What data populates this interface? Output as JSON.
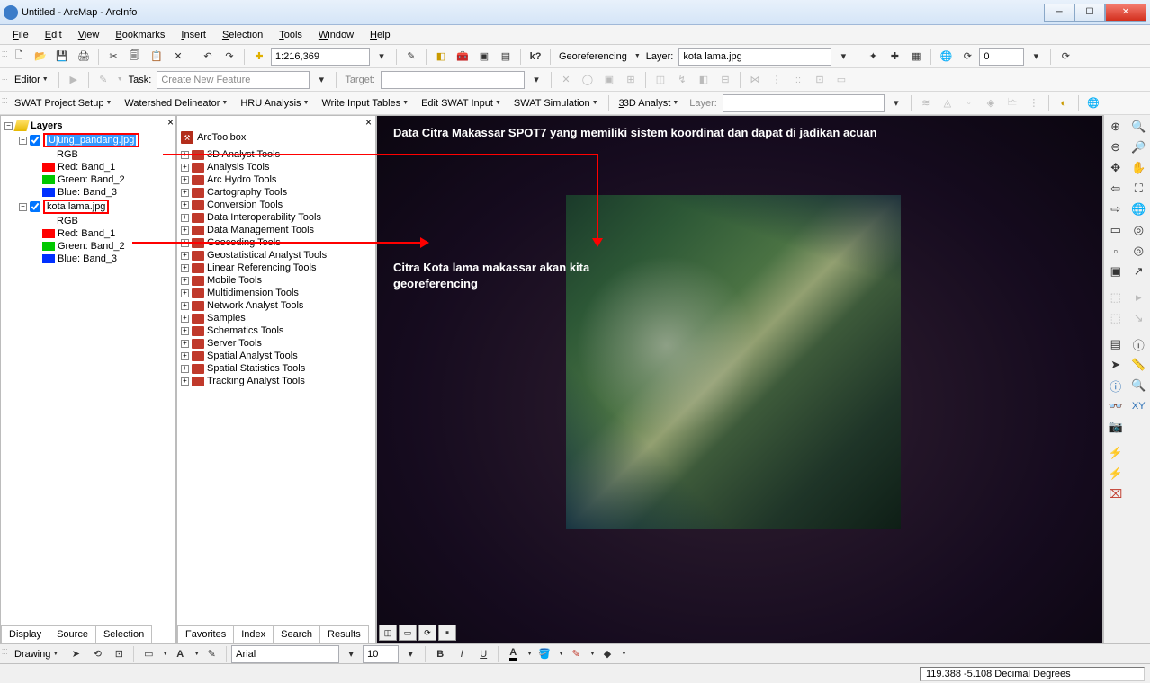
{
  "title": "Untitled - ArcMap - ArcInfo",
  "menu": [
    "File",
    "Edit",
    "View",
    "Bookmarks",
    "Insert",
    "Selection",
    "Tools",
    "Window",
    "Help"
  ],
  "scale": "1:216,369",
  "georef": {
    "label": "Georeferencing",
    "layer_label": "Layer:",
    "layer_value": "kota lama.jpg",
    "rotation": "0"
  },
  "editor": {
    "label": "Editor",
    "task": "Task:",
    "task_value": "Create New Feature",
    "target": "Target:"
  },
  "swat": [
    "SWAT Project Setup",
    "Watershed Delineator",
    "HRU Analysis",
    "Write Input Tables",
    "Edit SWAT Input",
    "SWAT Simulation"
  ],
  "analyst_3d": "3D Analyst",
  "toc": {
    "root": "Layers",
    "layer1": {
      "name": "Ujung_pandang.jpg",
      "rgb": "RGB",
      "bands": [
        "Red:   Band_1",
        "Green: Band_2",
        "Blue:   Band_3"
      ]
    },
    "layer2": {
      "name": "kota lama.jpg",
      "rgb": "RGB",
      "bands": [
        "Red:   Band_1",
        "Green: Band_2",
        "Blue:   Band_3"
      ]
    },
    "tabs": [
      "Display",
      "Source",
      "Selection"
    ]
  },
  "atb": {
    "title": "ArcToolbox",
    "items": [
      "3D Analyst Tools",
      "Analysis Tools",
      "Arc Hydro Tools",
      "Cartography Tools",
      "Conversion Tools",
      "Data Interoperability Tools",
      "Data Management Tools",
      "Geocoding Tools",
      "Geostatistical Analyst Tools",
      "Linear Referencing Tools",
      "Mobile Tools",
      "Multidimension Tools",
      "Network Analyst Tools",
      "Samples",
      "Schematics Tools",
      "Server Tools",
      "Spatial Analyst Tools",
      "Spatial Statistics Tools",
      "Tracking Analyst Tools"
    ],
    "tabs": [
      "Favorites",
      "Index",
      "Search",
      "Results"
    ]
  },
  "annotations": {
    "a1": "Data Citra Makassar SPOT7 yang memiliki sistem koordinat dan dapat di jadikan acuan",
    "a2": "Citra Kota lama makassar akan kita georeferencing"
  },
  "draw": {
    "label": "Drawing",
    "font": "Arial",
    "size": "10"
  },
  "status": "119.388   -5.108 Decimal Degrees",
  "layer_label_3d": "Layer:"
}
